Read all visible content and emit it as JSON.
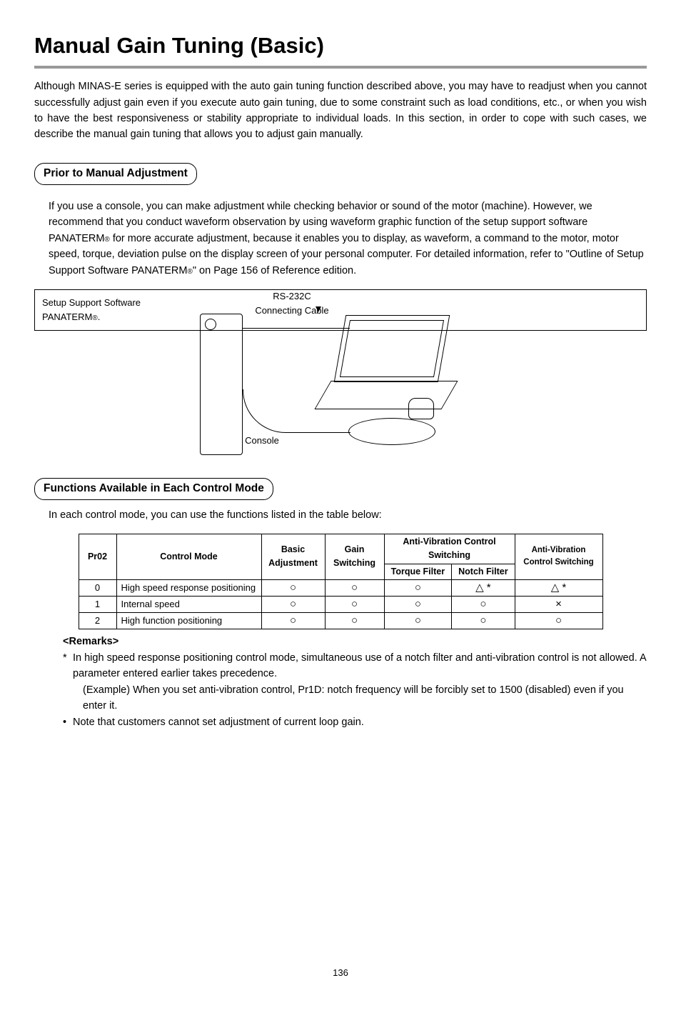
{
  "title": "Manual Gain Tuning (Basic)",
  "intro": "Although MINAS-E series is equipped with the auto gain tuning function described above, you may have to readjust when you cannot successfully adjust gain even if you execute auto gain tuning, due to some constraint such as load conditions, etc., or when you wish to have the best responsiveness or stability appropriate to individual loads. In this section, in order to cope with such cases, we describe the manual gain tuning that allows you to adjust gain manually.",
  "section1": {
    "heading": "Prior to Manual Adjustment",
    "body1": "If you use a console, you can make adjustment while checking behavior or sound of the motor (machine). However, we recommend that you conduct waveform observation by using waveform graphic function of the setup support software PANATERM",
    "body2": " for more accurate adjustment, because it enables you to display, as waveform, a command to the motor, motor speed, torque, deviation pulse on the display screen of your personal computer.  For detailed information, refer to \"Outline of Setup Support Software PANATERM",
    "body3": "\" on Page 156 of Reference edition.",
    "diagram": {
      "cable": "RS-232C Connecting Cable",
      "console": "Console",
      "sss_line1": "Setup Support Software",
      "sss_line2": "PANATERM"
    }
  },
  "section2": {
    "heading": "Functions Available in Each Control Mode",
    "lead": "In each control mode, you can use the functions listed in the table below:",
    "table": {
      "head": {
        "pr02": "Pr02",
        "mode": "Control Mode",
        "basic": "Basic Adjustment",
        "gain": "Gain Switching",
        "avcs": "Anti-Vibration Control Switching",
        "torque": "Torque Filter",
        "notch": "Notch Filter",
        "avctrl": "Anti-Vibration Control Switching"
      },
      "rows": [
        {
          "pr02": "0",
          "mode": "High speed response positioning",
          "basic": "○",
          "gain": "○",
          "torque": "○",
          "notch": "△ *",
          "avctrl": "△ *"
        },
        {
          "pr02": "1",
          "mode": "Internal speed",
          "basic": "○",
          "gain": "○",
          "torque": "○",
          "notch": "○",
          "avctrl": "×"
        },
        {
          "pr02": "2",
          "mode": "High function positioning",
          "basic": "○",
          "gain": "○",
          "torque": "○",
          "notch": "○",
          "avctrl": "○"
        }
      ]
    },
    "remarks_head": "<Remarks>",
    "remarks": [
      {
        "bullet": "*",
        "text": "In high speed response positioning control mode, simultaneous use of a notch filter and anti-vibration control is not allowed.  A parameter entered earlier takes precedence."
      },
      {
        "bullet": "",
        "text": "(Example)   When you set anti-vibration control, Pr1D: notch frequency will be forcibly set to 1500 (disabled) even if you enter it."
      },
      {
        "bullet": "•",
        "text": "Note that customers cannot set adjustment of current loop gain."
      }
    ]
  },
  "page_number": "136",
  "chart_data": {
    "type": "table",
    "title": "Functions Available in Each Control Mode",
    "columns": [
      "Pr02",
      "Control Mode",
      "Basic Adjustment",
      "Gain Switching",
      "Anti-Vibration Control Switching – Torque Filter",
      "Anti-Vibration Control Switching – Notch Filter",
      "Anti-Vibration Control Switching"
    ],
    "rows": [
      [
        "0",
        "High speed response positioning",
        "○",
        "○",
        "○",
        "△ *",
        "△ *"
      ],
      [
        "1",
        "Internal speed",
        "○",
        "○",
        "○",
        "○",
        "×"
      ],
      [
        "2",
        "High function positioning",
        "○",
        "○",
        "○",
        "○",
        "○"
      ]
    ]
  }
}
